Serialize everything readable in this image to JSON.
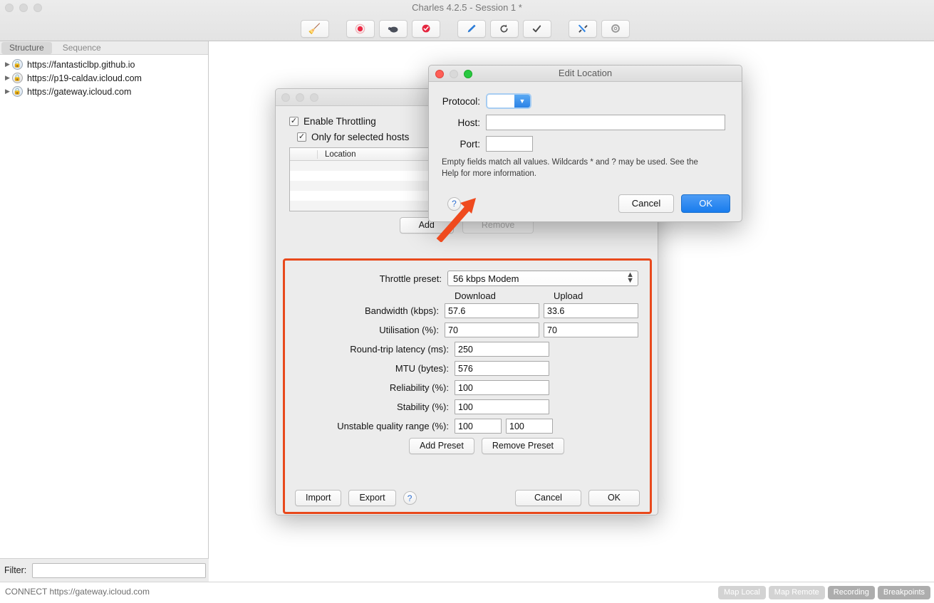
{
  "window": {
    "title": "Charles 4.2.5 - Session 1 *",
    "toolbar_buttons": [
      {
        "name": "clear-session",
        "glyph": "🧹"
      },
      {
        "name": "start-stop-recording",
        "glyph": "⏺"
      },
      {
        "name": "throttle-settings",
        "glyph": "🐢"
      },
      {
        "name": "breakpoints",
        "glyph": "⛔"
      },
      {
        "name": "compose",
        "glyph": "🖊"
      },
      {
        "name": "repeat",
        "glyph": "⟳"
      },
      {
        "name": "validate",
        "glyph": "✔"
      },
      {
        "name": "tools",
        "glyph": "🛠"
      },
      {
        "name": "settings",
        "glyph": "⚙"
      }
    ]
  },
  "sidebar": {
    "tabs": [
      {
        "label": "Structure",
        "active": true
      },
      {
        "label": "Sequence",
        "active": false
      }
    ],
    "tree": [
      {
        "label": "https://fantasticlbp.github.io",
        "icon": "secure-globe-icon",
        "icon_style": "blue"
      },
      {
        "label": "https://p19-caldav.icloud.com",
        "icon": "secure-globe-icon",
        "icon_style": "grey"
      },
      {
        "label": "https://gateway.icloud.com",
        "icon": "secure-globe-icon",
        "icon_style": "blue"
      }
    ],
    "filter_label": "Filter:",
    "filter_value": "",
    "filter_placeholder": ""
  },
  "statusbar": {
    "text": "CONNECT https://gateway.icloud.com",
    "badges": [
      {
        "label": "Map Local",
        "active": false
      },
      {
        "label": "Map Remote",
        "active": false
      },
      {
        "label": "Recording",
        "active": true
      },
      {
        "label": "Breakpoints",
        "active": true
      }
    ]
  },
  "throttle": {
    "enable_throttling_label": "Enable Throttling",
    "enable_throttling_checked": "✓",
    "only_selected_hosts_label": "Only for selected hosts",
    "only_selected_hosts_checked": "✓",
    "location_column_header": "Location",
    "location_rows": [],
    "add_label": "Add",
    "remove_label": "Remove",
    "preset_label": "Throttle preset:",
    "preset_value": "56 kbps Modem",
    "column_download": "Download",
    "column_upload": "Upload",
    "fields": [
      {
        "label": "Bandwidth (kbps):",
        "download": "57.6",
        "upload": "33.6",
        "two_col": true
      },
      {
        "label": "Utilisation (%):",
        "download": "70",
        "upload": "70",
        "two_col": true
      },
      {
        "label": "Round-trip latency (ms):",
        "download": "250",
        "upload": "",
        "two_col": false
      },
      {
        "label": "MTU (bytes):",
        "download": "576",
        "upload": "",
        "two_col": false
      },
      {
        "label": "Reliability (%):",
        "download": "100",
        "upload": "",
        "two_col": false
      },
      {
        "label": "Stability (%):",
        "download": "100",
        "upload": "",
        "two_col": false
      }
    ],
    "unstable_label": "Unstable quality range (%):",
    "unstable_min": "100",
    "unstable_max": "100",
    "add_preset_label": "Add Preset",
    "remove_preset_label": "Remove Preset",
    "import_label": "Import",
    "export_label": "Export",
    "help_label": "?",
    "cancel_label": "Cancel",
    "ok_label": "OK",
    "highlight_color": "#e8491c"
  },
  "edit_location": {
    "title": "Edit Location",
    "protocol_label": "Protocol:",
    "protocol_value": "",
    "host_label": "Host:",
    "host_value": "",
    "port_label": "Port:",
    "port_value": "",
    "note": "Empty fields match all values. Wildcards * and ? may be used. See the Help for more information.",
    "help_label": "?",
    "cancel_label": "Cancel",
    "ok_label": "OK",
    "accent_color": "#1a7ced"
  },
  "annotation": {
    "arrow_color": "#ef4a1e"
  }
}
